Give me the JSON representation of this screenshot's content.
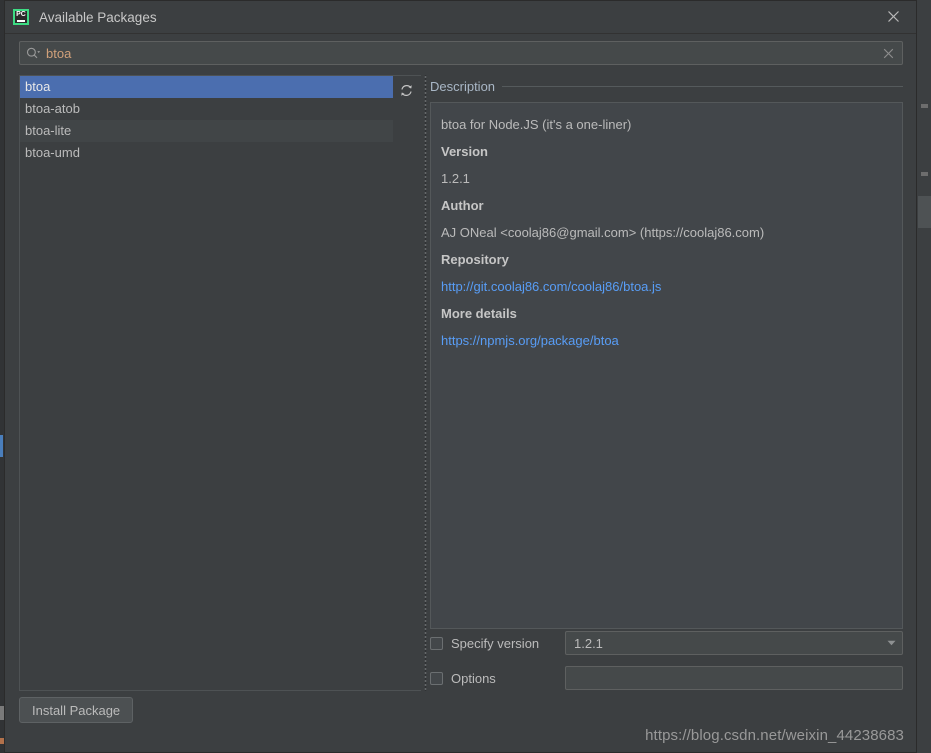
{
  "window": {
    "title": "Available Packages",
    "app_icon": "pycharm-icon",
    "app_icon_text": "PC",
    "app_icon_accent": "#3ddc84",
    "close_icon": "close-icon"
  },
  "search": {
    "icon": "search-icon",
    "value": "btoa",
    "placeholder": "",
    "clear_icon": "clear-icon"
  },
  "package_list": {
    "refresh_icon": "refresh-icon",
    "selected_index": 0,
    "items": [
      {
        "name": "btoa"
      },
      {
        "name": "btoa-atob"
      },
      {
        "name": "btoa-lite"
      },
      {
        "name": "btoa-umd"
      }
    ]
  },
  "description": {
    "legend": "Description",
    "summary": "btoa for Node.JS (it's a one-liner)",
    "fields": [
      {
        "heading": "Version",
        "value": "1.2.1",
        "is_link": false
      },
      {
        "heading": "Author",
        "value": "AJ ONeal  <coolaj86@gmail.com>  (https://coolaj86.com)",
        "is_link": false
      },
      {
        "heading": "Repository",
        "value": "http://git.coolaj86.com/coolaj86/btoa.js",
        "is_link": true
      },
      {
        "heading": "More details",
        "value": "https://npmjs.org/package/btoa",
        "is_link": true
      }
    ],
    "link_color": "#589df6"
  },
  "options": {
    "specify_version": {
      "label": "Specify version",
      "checked": false,
      "value": "1.2.1",
      "dropdown_icon": "chevron-down-icon"
    },
    "options_field": {
      "label": "Options",
      "checked": false,
      "value": "",
      "placeholder": ""
    }
  },
  "footer": {
    "install_label": "Install Package",
    "watermark": "https://blog.csdn.net/weixin_44238683"
  },
  "colors": {
    "dialog_bg": "#3c3f41",
    "panel_bg": "#42464a",
    "selection": "#4b6eaf",
    "text": "#bbbbbb",
    "accent_green": "#3ddc84",
    "search_text": "#d0a07a"
  }
}
